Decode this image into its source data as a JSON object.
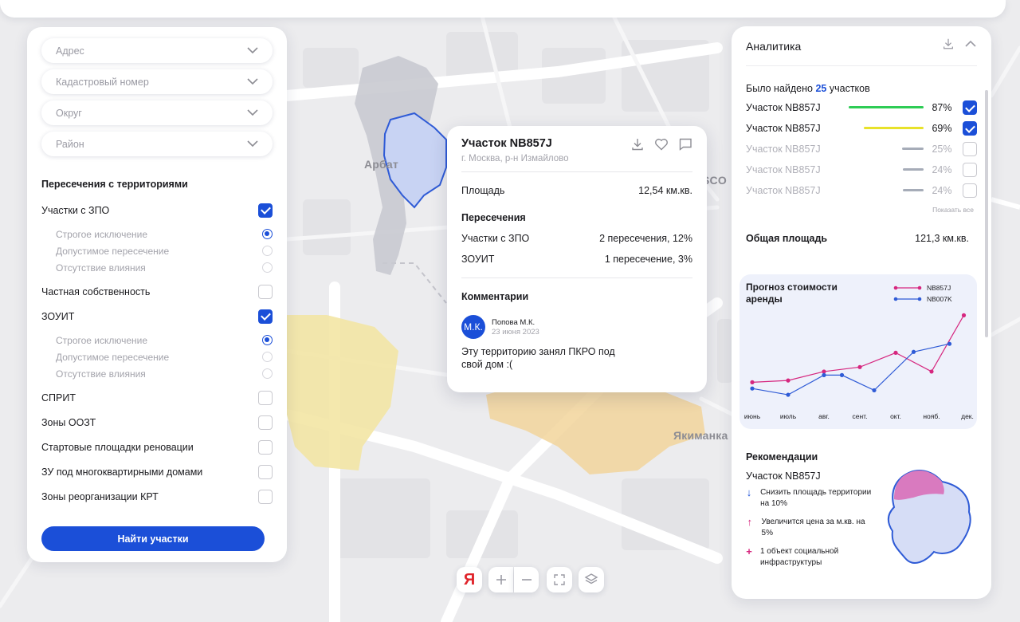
{
  "map": {
    "labels": {
      "arbat": "Арбат",
      "yakimanka": "Якиманка",
      "partial": "SCO"
    }
  },
  "filters": {
    "dropdowns": [
      {
        "placeholder": "Адрес"
      },
      {
        "placeholder": "Кадастровый номер"
      },
      {
        "placeholder": "Округ"
      },
      {
        "placeholder": "Район"
      }
    ],
    "section_title": "Пересечения с территориями",
    "zpo": {
      "label": "Участки с ЗПО",
      "checked": true,
      "options": [
        "Строгое исключение",
        "Допустимое пересечение",
        "Отсутствие влияния"
      ],
      "selected_option": "Строгое исключение"
    },
    "private": {
      "label": "Частная собственность",
      "checked": false
    },
    "zouit": {
      "label": "ЗОУИТ",
      "checked": true,
      "options": [
        "Строгое исключение",
        "Допустимое пересечение",
        "Отсутствие влияния"
      ],
      "selected_option": "Строгое исключение"
    },
    "others": [
      {
        "label": "СПРИТ",
        "checked": false
      },
      {
        "label": "Зоны ООЗТ",
        "checked": false
      },
      {
        "label": "Стартовые площадки реновации",
        "checked": false
      },
      {
        "label": "ЗУ под многоквартирными домами",
        "checked": false
      },
      {
        "label": "Зоны реорганизации КРТ",
        "checked": false
      }
    ],
    "find_button": "Найти участки"
  },
  "popup": {
    "title": "Участок NB857J",
    "address": "г. Москва, р-н Измайлово",
    "area_label": "Площадь",
    "area_value": "12,54 км.кв.",
    "intersections_title": "Пересечения",
    "intersections": [
      {
        "label": "Участки с ЗПО",
        "value": "2 пересечения, 12%"
      },
      {
        "label": "ЗОУИТ",
        "value": "1 пересечение, 3%"
      }
    ],
    "comments_title": "Комментарии",
    "comment": {
      "initials": "М.К.",
      "author": "Попова М.К.",
      "date": "23 июня 2023",
      "text": "Эту территорию занял ПКРО под свой дом :("
    }
  },
  "analytics": {
    "title": "Аналитика",
    "found_prefix": "Было найдено",
    "found_count": "25",
    "found_suffix": "участков",
    "plots": [
      {
        "name": "Участок NB857J",
        "percent": "87%",
        "value": 0.87,
        "color": "#2ecc55",
        "checked": true,
        "dim": false
      },
      {
        "name": "Участок NB857J",
        "percent": "69%",
        "value": 0.69,
        "color": "#e8e22a",
        "checked": true,
        "dim": false
      },
      {
        "name": "Участок NB857J",
        "percent": "25%",
        "value": 0.25,
        "color": "#a6acb8",
        "checked": false,
        "dim": true
      },
      {
        "name": "Участок NB857J",
        "percent": "24%",
        "value": 0.24,
        "color": "#a6acb8",
        "checked": false,
        "dim": true
      },
      {
        "name": "Участок NB857J",
        "percent": "24%",
        "value": 0.24,
        "color": "#a6acb8",
        "checked": false,
        "dim": true
      }
    ],
    "show_all": "Показать все",
    "total_label": "Общая площадь",
    "total_value": "121,3 км.кв.",
    "forecast_title": "Прогноз стоимости аренды",
    "recommendations_title": "Рекомендации",
    "recommendation_plot": "Участок NB857J",
    "recommendations": [
      {
        "icon": "arrow-down-icon",
        "symbol": "↓",
        "color": "#1b4fd8",
        "text": "Снизить площадь территории на 10%"
      },
      {
        "icon": "arrow-up-icon",
        "symbol": "↑",
        "color": "#d6277f",
        "text": "Увеличится цена за м.кв. на 5%"
      },
      {
        "icon": "plus-icon",
        "symbol": "+",
        "color": "#d6277f",
        "text": "1 объект социальной инфраструктуры"
      }
    ]
  },
  "chart_data": {
    "type": "line",
    "title": "Прогноз стоимости аренды",
    "categories": [
      "июнь",
      "июль",
      "авг.",
      "сент.",
      "окт.",
      "нояб.",
      "дек."
    ],
    "series": [
      {
        "name": "NB857J",
        "color": "#d6277f",
        "values": [
          2.2,
          2.4,
          3.4,
          3.9,
          5.5,
          3.4,
          9.7
        ]
      },
      {
        "name": "NB007K",
        "color": "#2f5bd6",
        "values": [
          1.5,
          0.8,
          3.0,
          3.0,
          1.3,
          5.6,
          6.5
        ]
      }
    ],
    "x_points": [
      0,
      1,
      2,
      3,
      4,
      5,
      6,
      7
    ],
    "values_x": {
      "NB857J": [
        0,
        1,
        2,
        3,
        4,
        5,
        5.9
      ],
      "NB007K": [
        0,
        1,
        2,
        2.5,
        3.4,
        4.5,
        5.5
      ]
    },
    "ylim": [
      0,
      10
    ],
    "grid": false,
    "legend": "top-right"
  },
  "map_controls": {
    "yandex": "Я"
  },
  "colors": {
    "accent": "#1b4fd8",
    "highlight": "#d6277f"
  }
}
